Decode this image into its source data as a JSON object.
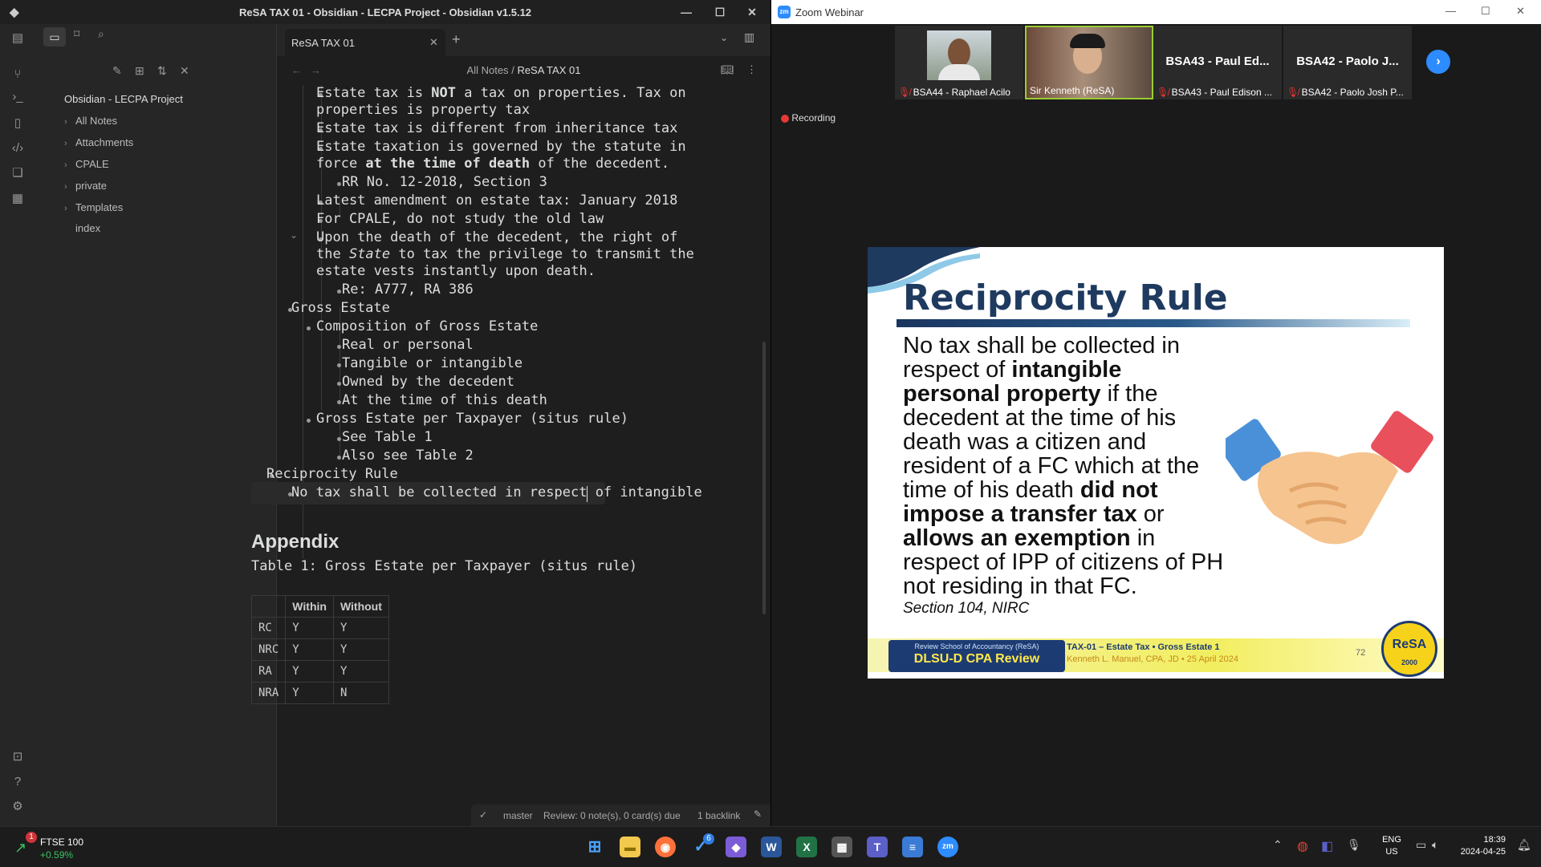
{
  "obsidian": {
    "window_title": "ReSA TAX 01 - Obsidian - LECPA Project - Obsidian v1.5.12",
    "vault_name": "Obsidian - LECPA Project",
    "folders": [
      {
        "label": "All Notes"
      },
      {
        "label": "Attachments"
      },
      {
        "label": "CPALE"
      },
      {
        "label": "private"
      },
      {
        "label": "Templates"
      }
    ],
    "files": [
      {
        "label": "index"
      }
    ],
    "tab_title": "ReSA TAX 01",
    "breadcrumb": {
      "parent": "All Notes",
      "sep": "/",
      "current": "ReSA TAX 01"
    },
    "content": {
      "l1": "Estate tax is ",
      "l1b": "NOT",
      "l1c": " a tax on properties. Tax on",
      "l2": "properties is property tax",
      "l3": "Estate tax is different from inheritance tax",
      "l4": "Estate taxation is governed by the statute in",
      "l5a": "force ",
      "l5b": "at the time of death",
      "l5c": " of the decedent.",
      "l6": "RR No. 12-2018, Section 3",
      "l7": "Latest amendment on estate tax: January 2018",
      "l8": "For CPALE, do not study the old law",
      "l9": "Upon the death of the decedent, the right of",
      "l10a": "the ",
      "l10b": "State",
      "l10c": " to tax the privilege to transmit the",
      "l11": "estate vests instantly upon death.",
      "l12": "Re: A777, RA 386",
      "l13": "Gross Estate",
      "l14": "Composition of Gross Estate",
      "l15": "Real or personal",
      "l16": "Tangible or intangible",
      "l17": "Owned by the decedent",
      "l18": "At the time of this death",
      "l19": "Gross Estate per Taxpayer (situs rule)",
      "l20": "See Table 1",
      "l21": "Also see Table 2",
      "l22": "Reciprocity Rule",
      "l23": "No tax shall be collected in respect of intangible"
    },
    "appendix_heading": "Appendix",
    "table1_caption": "Table 1: Gross Estate per Taxpayer (situs rule)",
    "table1": {
      "headers": [
        "",
        "Within",
        "Without"
      ],
      "rows": [
        [
          "RC",
          "Y",
          "Y"
        ],
        [
          "NRC",
          "Y",
          "Y"
        ],
        [
          "RA",
          "Y",
          "Y"
        ],
        [
          "NRA",
          "Y",
          "N"
        ]
      ]
    },
    "status": {
      "branch": "master",
      "review": "Review: 0 note(s), 0 card(s) due",
      "backlinks": "1 backlink"
    }
  },
  "zoom": {
    "window_title": "Zoom Webinar",
    "participants": [
      {
        "name": "BSA44 - Raphael Acilo",
        "muted": true
      },
      {
        "name": "Sir Kenneth (ReSA)",
        "muted": false
      },
      {
        "name": "BSA43 - Paul Edison ...",
        "big_label": "BSA43 - Paul Ed...",
        "muted": true
      },
      {
        "name": "BSA42 - Paolo Josh P...",
        "big_label": "BSA42 - Paolo J...",
        "muted": true
      }
    ],
    "recording_label": "Recording",
    "slide": {
      "title": "Reciprocity Rule",
      "body": [
        {
          "t": "No tax shall be collected in ",
          "b": false
        },
        {
          "t": "respect of ",
          "b": false
        },
        {
          "t": "intangible personal property",
          "b": true
        },
        {
          "t": " if the decedent at the time of his death was a citizen and resident of a FC which at the time of his death ",
          "b": false
        },
        {
          "t": "did not impose a transfer tax",
          "b": true
        },
        {
          "t": " or ",
          "b": false
        },
        {
          "t": "allows an exemption",
          "b": true
        },
        {
          "t": " in respect of IPP of citizens of PH not residing in that FC.",
          "b": false
        }
      ],
      "source": "Section 104, NIRC",
      "footer_school": "Review School of Accountancy (ReSA)",
      "footer_program": "DLSU-D CPA Review",
      "footer_course": "TAX-01 – Estate Tax • Gross Estate 1",
      "footer_author": "Kenneth L. Manuel, CPA, JD • 25 April 2024",
      "page_number": "72",
      "seal_text": "ReSA",
      "seal_year": "2000"
    }
  },
  "taskbar": {
    "stock_name": "FTSE 100",
    "stock_change": "+0.59%",
    "stock_badge": "1",
    "lang": "ENG",
    "region": "US",
    "time": "18:39",
    "date": "2024-04-25",
    "badge_count": "6"
  }
}
